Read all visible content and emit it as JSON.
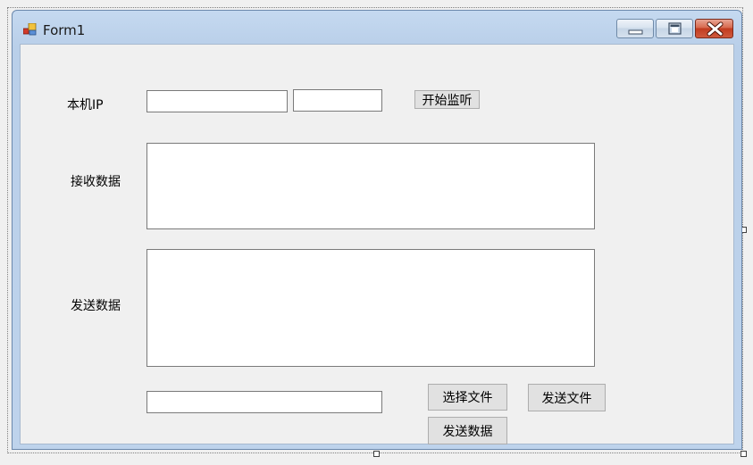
{
  "window": {
    "title": "Form1",
    "accent_color": "#b9cfe9",
    "close_color": "#c13b1f"
  },
  "form": {
    "local_ip_label": "本机IP",
    "ip_input_value": "",
    "port_input_value": "",
    "start_listen_button": "开始监听",
    "receive_label": "接收数据",
    "receive_text": "",
    "send_label": "发送数据",
    "send_text": "",
    "file_path_value": "",
    "select_file_button": "选择文件",
    "send_file_button": "发送文件",
    "send_data_button": "发送数据"
  },
  "icons": {
    "app": "app-icon",
    "minimize": "minimize-icon",
    "maximize": "maximize-icon",
    "close": "close-icon"
  }
}
